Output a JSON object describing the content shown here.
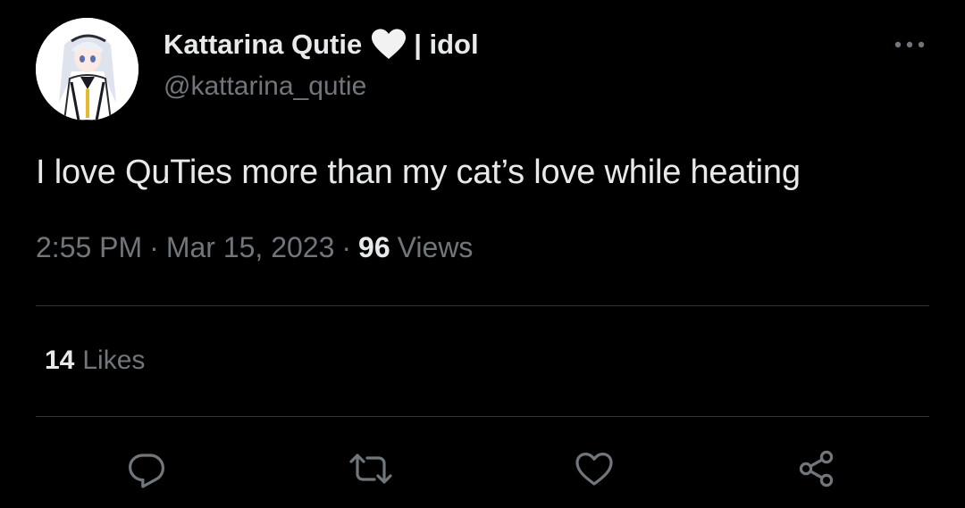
{
  "author": {
    "display_name": "Kattarina Qutie",
    "name_emoji": "white-heart-icon",
    "name_suffix": "| idol",
    "handle": "@kattarina_qutie",
    "avatar": "anime-avatar"
  },
  "tweet": {
    "text": "I love QuTies more than my cat’s love while heating",
    "time": "2:55 PM",
    "separator": "·",
    "date": "Mar 15, 2023",
    "views_count": "96",
    "views_label": "Views"
  },
  "stats": {
    "likes_count": "14",
    "likes_label": "Likes"
  },
  "actions": [
    {
      "name": "reply",
      "icon": "reply-icon"
    },
    {
      "name": "retweet",
      "icon": "retweet-icon"
    },
    {
      "name": "like",
      "icon": "heart-outline-icon"
    },
    {
      "name": "share",
      "icon": "share-icon"
    }
  ],
  "menu": {
    "icon": "more-icon"
  },
  "colors": {
    "background": "#000000",
    "primary_text": "#e7e9ea",
    "secondary_text": "#71767b",
    "divider": "#2f3336"
  }
}
